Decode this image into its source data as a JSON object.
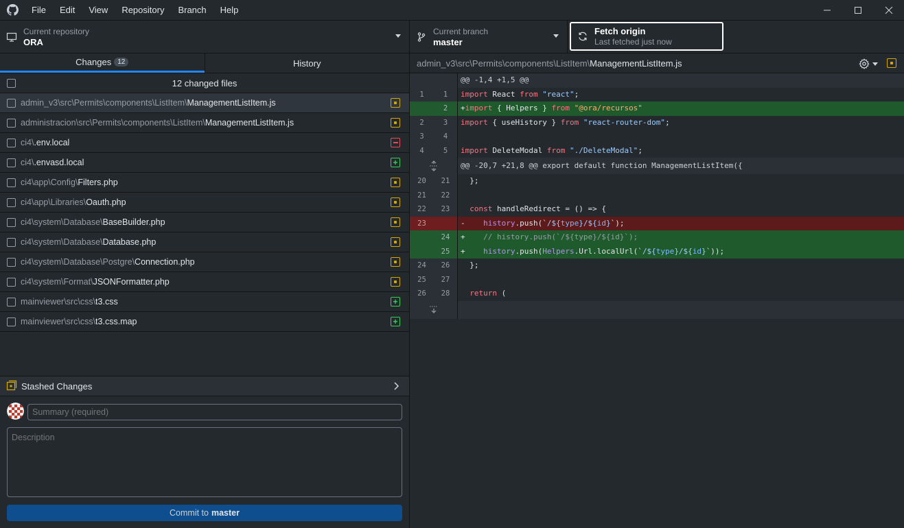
{
  "menu": {
    "items": [
      "File",
      "Edit",
      "View",
      "Repository",
      "Branch",
      "Help"
    ]
  },
  "toolbar": {
    "repo_label": "Current repository",
    "repo_value": "ORA",
    "branch_label": "Current branch",
    "branch_value": "master",
    "fetch_label": "Fetch origin",
    "fetch_sub": "Last fetched just now"
  },
  "tabs": {
    "changes_label": "Changes",
    "changes_count": "12",
    "history_label": "History"
  },
  "changes": {
    "header": "12 changed files",
    "files": [
      {
        "dir": "admin_v3\\src\\Permits\\components\\ListItem\\",
        "name": "ManagementListItem.js",
        "status": "modified",
        "selected": true
      },
      {
        "dir": "administracion\\src\\Permits\\components\\ListItem\\",
        "name": "ManagementListItem.js",
        "status": "modified",
        "selected": false
      },
      {
        "dir": "ci4\\",
        "name": ".env.local",
        "status": "deleted",
        "selected": false
      },
      {
        "dir": "ci4\\",
        "name": ".envasd.local",
        "status": "added",
        "selected": false
      },
      {
        "dir": "ci4\\app\\Config\\",
        "name": "Filters.php",
        "status": "modified",
        "selected": false
      },
      {
        "dir": "ci4\\app\\Libraries\\",
        "name": "Oauth.php",
        "status": "modified",
        "selected": false
      },
      {
        "dir": "ci4\\system\\Database\\",
        "name": "BaseBuilder.php",
        "status": "modified",
        "selected": false
      },
      {
        "dir": "ci4\\system\\Database\\",
        "name": "Database.php",
        "status": "modified",
        "selected": false
      },
      {
        "dir": "ci4\\system\\Database\\Postgre\\",
        "name": "Connection.php",
        "status": "modified",
        "selected": false
      },
      {
        "dir": "ci4\\system\\Format\\",
        "name": "JSONFormatter.php",
        "status": "modified",
        "selected": false
      },
      {
        "dir": "mainviewer\\src\\css\\",
        "name": "t3.css",
        "status": "added",
        "selected": false
      },
      {
        "dir": "mainviewer\\src\\css\\",
        "name": "t3.css.map",
        "status": "added",
        "selected": false
      }
    ]
  },
  "stash": {
    "label": "Stashed Changes"
  },
  "commit": {
    "summary_placeholder": "Summary (required)",
    "description_placeholder": "Description",
    "button_prefix": "Commit to",
    "button_branch": "master"
  },
  "diff": {
    "file_dir": "admin_v3\\src\\Permits\\components\\ListItem\\",
    "file_name": "ManagementListItem.js",
    "hunk1": "@@ -1,4 +1,5 @@",
    "hunk2": "@@ -20,7 +21,8 @@ export default function ManagementListItem({",
    "lines": [
      {
        "type": "ctx",
        "old": "1",
        "new": "1",
        "code": [
          [
            "kw",
            "import"
          ],
          [
            "plain",
            " React "
          ],
          [
            "kw",
            "from"
          ],
          [
            "plain",
            " "
          ],
          [
            "str",
            "\"react\""
          ],
          [
            "plain",
            ";"
          ]
        ]
      },
      {
        "type": "add",
        "old": "",
        "new": "2",
        "code": [
          [
            "plain",
            "+"
          ],
          [
            "kw",
            "import"
          ],
          [
            "plain",
            " { Helpers } "
          ],
          [
            "kw",
            "from"
          ],
          [
            "plain",
            " "
          ],
          [
            "str2",
            "\"@ora/recursos\""
          ]
        ]
      },
      {
        "type": "ctx",
        "old": "2",
        "new": "3",
        "code": [
          [
            "kw",
            "import"
          ],
          [
            "plain",
            " { useHistory } "
          ],
          [
            "kw",
            "from"
          ],
          [
            "plain",
            " "
          ],
          [
            "str",
            "\"react-router-dom\""
          ],
          [
            "plain",
            ";"
          ]
        ]
      },
      {
        "type": "ctx",
        "old": "3",
        "new": "4",
        "code": [
          [
            "plain",
            ""
          ]
        ]
      },
      {
        "type": "ctx",
        "old": "4",
        "new": "5",
        "code": [
          [
            "kw",
            "import"
          ],
          [
            "plain",
            " DeleteModal "
          ],
          [
            "kw",
            "from"
          ],
          [
            "plain",
            " "
          ],
          [
            "str",
            "\"./DeleteModal\""
          ],
          [
            "plain",
            ";"
          ]
        ]
      }
    ],
    "lines2": [
      {
        "type": "ctx",
        "old": "20",
        "new": "21",
        "code": [
          [
            "plain",
            "  };"
          ]
        ]
      },
      {
        "type": "ctx",
        "old": "21",
        "new": "22",
        "code": [
          [
            "plain",
            ""
          ]
        ]
      },
      {
        "type": "ctx",
        "old": "22",
        "new": "23",
        "code": [
          [
            "plain",
            "  "
          ],
          [
            "kw",
            "const"
          ],
          [
            "plain",
            " handleRedirect = () => {"
          ]
        ]
      },
      {
        "type": "del",
        "old": "23",
        "new": "",
        "code": [
          [
            "plain",
            "-    "
          ],
          [
            "var",
            "history"
          ],
          [
            "plain",
            ".push(`"
          ],
          [
            "str",
            "/${"
          ],
          [
            "blue",
            "type"
          ],
          [
            "str",
            "}/${"
          ],
          [
            "blue",
            "id"
          ],
          [
            "str",
            "}"
          ],
          [
            "plain",
            "`);"
          ]
        ]
      },
      {
        "type": "add",
        "old": "",
        "new": "24",
        "code": [
          [
            "plain",
            "+    "
          ],
          [
            "cmt",
            "// history.push(`/${type}/${id}`);"
          ]
        ]
      },
      {
        "type": "add",
        "old": "",
        "new": "25",
        "code": [
          [
            "plain",
            "+    "
          ],
          [
            "var",
            "history"
          ],
          [
            "plain",
            ".push("
          ],
          [
            "var",
            "Helpers"
          ],
          [
            "plain",
            ".Url.localUrl(`"
          ],
          [
            "str",
            "/${"
          ],
          [
            "blue",
            "type"
          ],
          [
            "str",
            "}/${"
          ],
          [
            "blue",
            "id"
          ],
          [
            "str",
            "}"
          ],
          [
            "plain",
            "`));"
          ]
        ]
      },
      {
        "type": "ctx",
        "old": "24",
        "new": "26",
        "code": [
          [
            "plain",
            "  };"
          ]
        ]
      },
      {
        "type": "ctx",
        "old": "25",
        "new": "27",
        "code": [
          [
            "plain",
            ""
          ]
        ]
      },
      {
        "type": "ctx",
        "old": "26",
        "new": "28",
        "code": [
          [
            "plain",
            "  "
          ],
          [
            "kw",
            "return"
          ],
          [
            "plain",
            " ("
          ]
        ]
      }
    ]
  }
}
